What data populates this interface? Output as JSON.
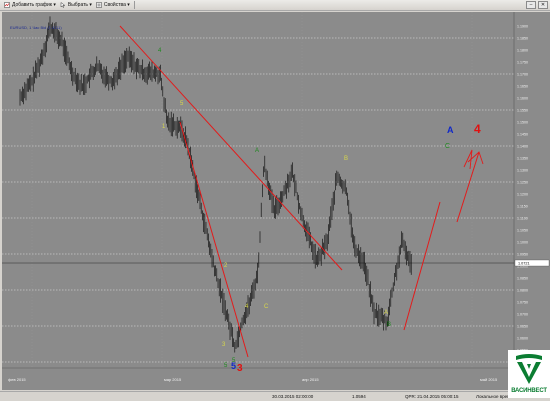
{
  "toolbar": {
    "add_chart_label": "Добавить график",
    "select_label": "Выбрать",
    "properties_label": "Свойства"
  },
  "chart": {
    "instrument_label": "EURUSD, 1 Час Bid (1:4111)",
    "price_labels": [
      "1.1900",
      "1.1850",
      "1.1800",
      "1.1750",
      "1.1700",
      "1.1650",
      "1.1600",
      "1.1550",
      "1.1500",
      "1.1450",
      "1.1400",
      "1.1350",
      "1.1300",
      "1.1250",
      "1.1200",
      "1.1150",
      "1.1100",
      "1.1050",
      "1.1000",
      "1.0950",
      "1.0900",
      "1.0850",
      "1.0800",
      "1.0750",
      "1.0700",
      "1.0650",
      "1.0600",
      "1.0550",
      "1.0500"
    ],
    "current_price": "1.0721",
    "date_labels": [
      "фев 2015",
      "мар 2015",
      "апр 2015",
      "май 2015"
    ],
    "wave_labels": [
      "4",
      "5",
      "A",
      "B",
      "C",
      "1",
      "2",
      "3",
      "4",
      "5",
      "A",
      "B"
    ],
    "forecast_labels": {
      "blue": "A",
      "green": "C",
      "red": "4"
    },
    "bottom_labels": {
      "blue5": "5",
      "red3": "3",
      "left5": "5"
    },
    "colors": {
      "background": "#8b8b8b",
      "candles": "#000000",
      "trendline": "#e31b1b",
      "grid": "#e8e8e8",
      "wave_green": "#1e8a1e",
      "wave_yellow": "#d7d74a",
      "blue": "#1028c8"
    }
  },
  "status": {
    "cursor_time": "30.03.2015 02:00:00",
    "cursor_price": "1.0594",
    "server_time": "QPR: 21.04.2015 05:00:15",
    "local_label": "Локальное врем"
  },
  "logo": {
    "text": "ВАСИНВЕСТ"
  }
}
